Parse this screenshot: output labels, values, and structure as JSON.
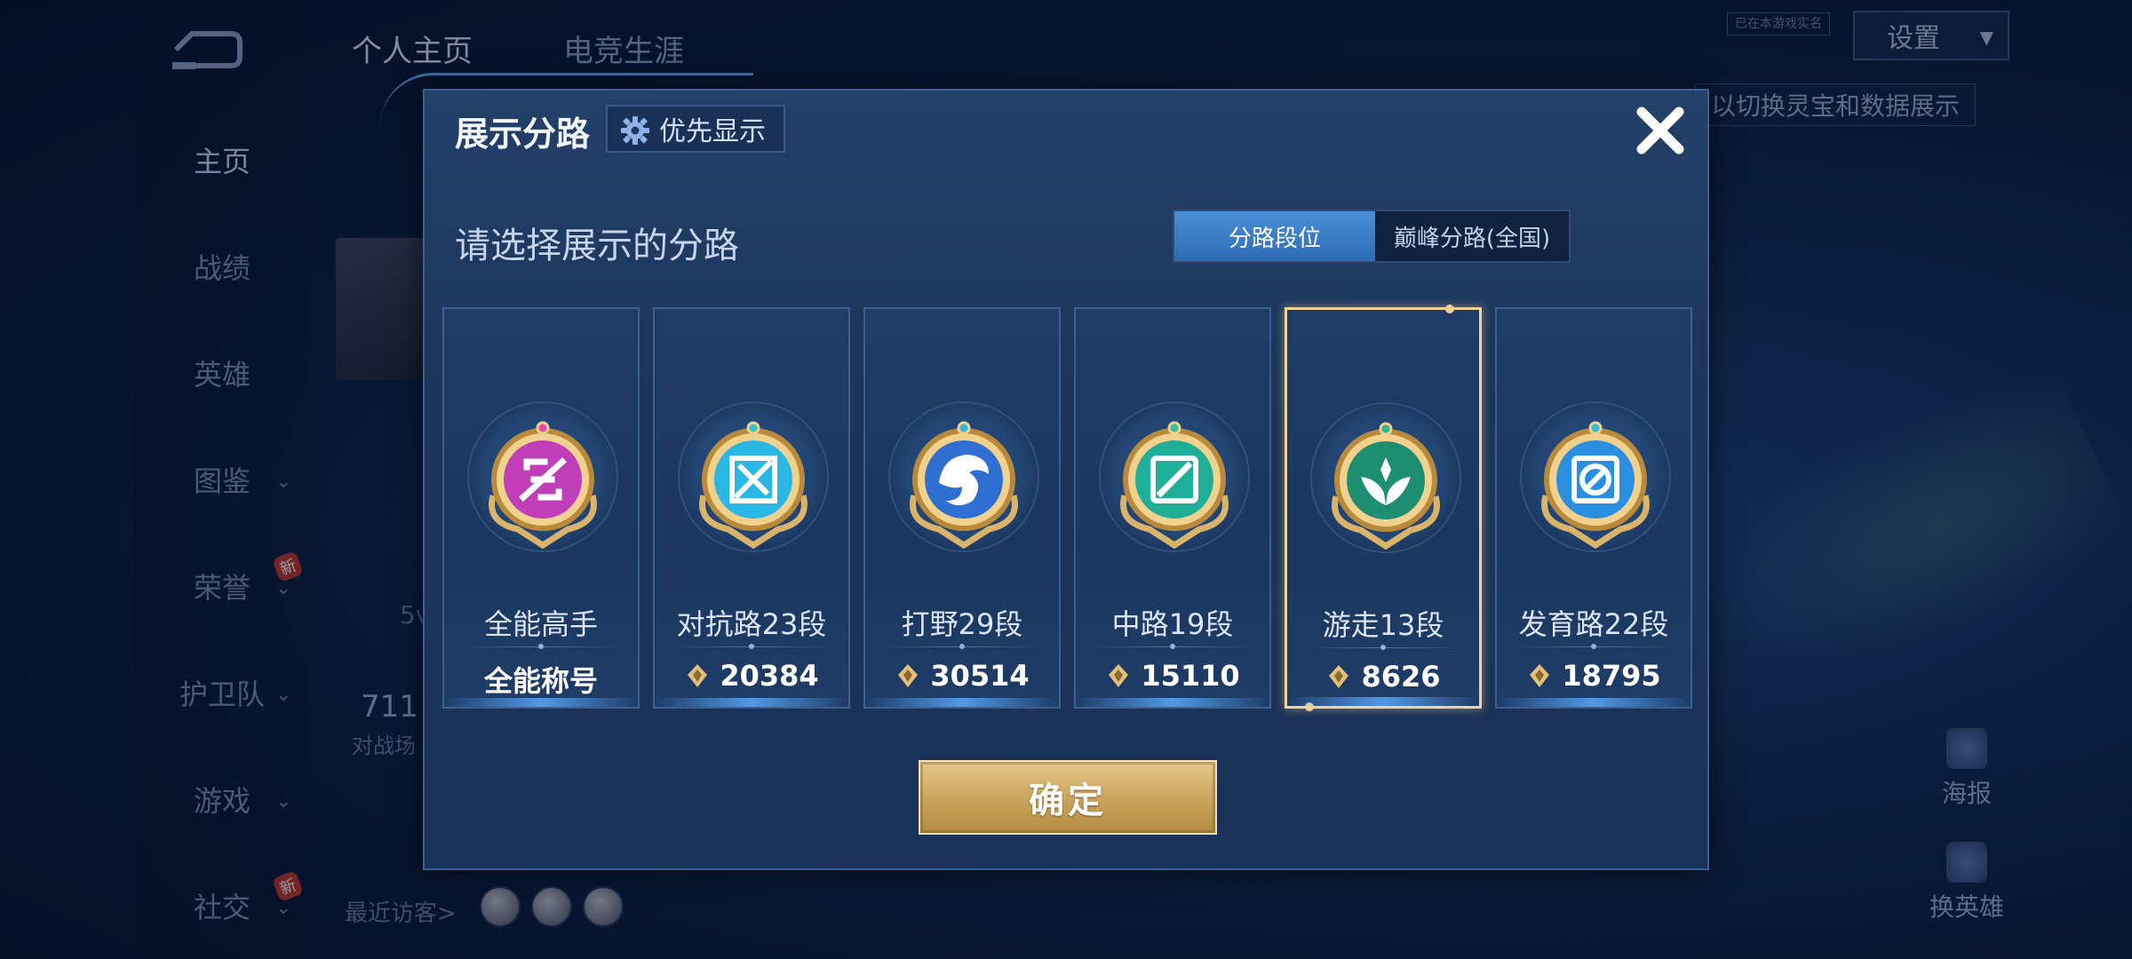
{
  "background": {
    "top_tabs": [
      "个人主页",
      "电竞生涯"
    ],
    "nav_items": [
      {
        "label": "主页",
        "has_chevron": false,
        "new": false
      },
      {
        "label": "战绩",
        "has_chevron": false,
        "new": false
      },
      {
        "label": "英雄",
        "has_chevron": false,
        "new": false
      },
      {
        "label": "图鉴",
        "has_chevron": true,
        "new": false
      },
      {
        "label": "荣誉",
        "has_chevron": true,
        "new": true
      },
      {
        "label": "护卫队",
        "has_chevron": true,
        "new": false
      },
      {
        "label": "游戏",
        "has_chevron": true,
        "new": false
      },
      {
        "label": "社交",
        "has_chevron": true,
        "new": true
      }
    ],
    "new_badge": "新",
    "settings_label": "设置",
    "realname_badge": "已在本游戏实名",
    "hint_text": "以切换灵宝和数据展示",
    "partial_texts": [
      "5v",
      "711",
      "对战场"
    ],
    "recent_visitors_label": "最近访客>",
    "right_buttons": [
      "海报",
      "换英雄"
    ]
  },
  "modal": {
    "title": "展示分路",
    "priority_button": "优先显示",
    "subtitle": "请选择展示的分路",
    "toggle": {
      "active": "分路段位",
      "inactive": "巅峰分路(全国)"
    },
    "cards": [
      {
        "name": "全能高手",
        "value": "全能称号",
        "has_points_icon": false,
        "selected": false,
        "emblem": "all-round-emblem-icon",
        "color": "#c03fb8"
      },
      {
        "name": "对抗路23段",
        "value": "20384",
        "has_points_icon": true,
        "selected": false,
        "emblem": "clash-lane-emblem-icon",
        "color": "#2ab7e6"
      },
      {
        "name": "打野29段",
        "value": "30514",
        "has_points_icon": true,
        "selected": false,
        "emblem": "jungle-emblem-icon",
        "color": "#2f6fd1"
      },
      {
        "name": "中路19段",
        "value": "15110",
        "has_points_icon": true,
        "selected": false,
        "emblem": "mid-lane-emblem-icon",
        "color": "#1fae98"
      },
      {
        "name": "游走13段",
        "value": "8626",
        "has_points_icon": true,
        "selected": true,
        "emblem": "roam-emblem-icon",
        "color": "#1d8f70"
      },
      {
        "name": "发育路22段",
        "value": "18795",
        "has_points_icon": true,
        "selected": false,
        "emblem": "farm-lane-emblem-icon",
        "color": "#2a8fe0"
      }
    ],
    "confirm_label": "确定"
  },
  "colors": {
    "accent_blue": "#3f86d4",
    "gold": "#d4b06a",
    "selected_border": "#f1d39a"
  }
}
